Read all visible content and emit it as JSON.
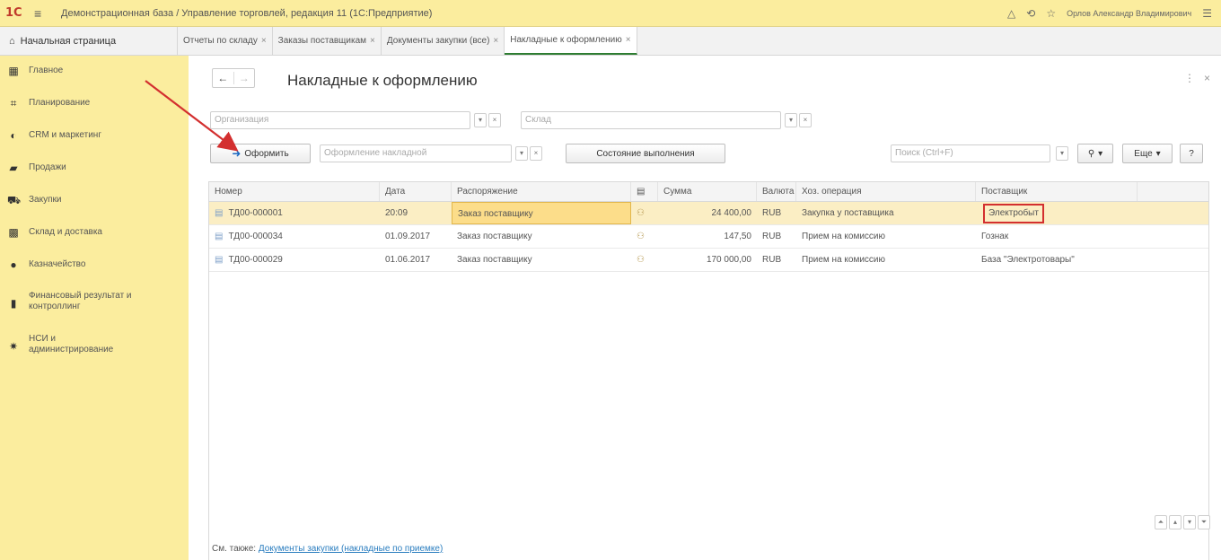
{
  "app": {
    "logo": "1С",
    "title": "Демонстрационная база / Управление торговлей, редакция 11  (1С:Предприятие)",
    "user": "Орлов Александр Владимирович"
  },
  "tabs": {
    "home": "Начальная страница",
    "items": [
      {
        "label": "Отчеты по складу"
      },
      {
        "label": "Заказы поставщикам"
      },
      {
        "label": "Документы закупки (все)"
      },
      {
        "label": "Накладные к оформлению"
      }
    ]
  },
  "sidebar": {
    "items": [
      {
        "label": "Главное",
        "icon": "grid-icon"
      },
      {
        "label": "Планирование",
        "icon": "planning-icon"
      },
      {
        "label": "CRM и маркетинг",
        "icon": "crm-icon"
      },
      {
        "label": "Продажи",
        "icon": "sales-icon"
      },
      {
        "label": "Закупки",
        "icon": "cart-icon"
      },
      {
        "label": "Склад и доставка",
        "icon": "warehouse-icon"
      },
      {
        "label": "Казначейство",
        "icon": "treasury-icon"
      },
      {
        "label": "Финансовый результат и контроллинг",
        "icon": "chart-icon"
      },
      {
        "label": "НСИ и администрирование",
        "icon": "gear-icon"
      }
    ]
  },
  "page": {
    "title": "Накладные к оформлению",
    "org_placeholder": "Организация",
    "warehouse_placeholder": "Склад",
    "process_button": "Оформить",
    "invoice_placeholder": "Оформление накладной",
    "status_button": "Состояние выполнения",
    "search_placeholder": "Поиск (Ctrl+F)",
    "more_button": "Еще",
    "help_button": "?"
  },
  "table": {
    "headers": {
      "number": "Номер",
      "date": "Дата",
      "order": "Распоряжение",
      "sum": "Сумма",
      "currency": "Валюта",
      "operation": "Хоз. операция",
      "supplier": "Поставщик"
    },
    "rows": [
      {
        "number": "ТД00-000001",
        "date": "20:09",
        "order": "Заказ поставщику",
        "sum": "24 400,00",
        "currency": "RUB",
        "operation": "Закупка у поставщика",
        "supplier": "Электробыт"
      },
      {
        "number": "ТД00-000034",
        "date": "01.09.2017",
        "order": "Заказ поставщику",
        "sum": "147,50",
        "currency": "RUB",
        "operation": "Прием на комиссию",
        "supplier": "Гознак"
      },
      {
        "number": "ТД00-000029",
        "date": "01.06.2017",
        "order": "Заказ поставщику",
        "sum": "170 000,00",
        "currency": "RUB",
        "operation": "Прием на комиссию",
        "supplier": "База \"Электротовары\""
      }
    ]
  },
  "footer": {
    "prefix": "См. также:",
    "link": "Документы закупки (накладные по приемке)"
  },
  "colors": {
    "header_bg": "#fbed9e",
    "selected_row": "#fbeec4",
    "annotation_red": "#d32f2f"
  }
}
